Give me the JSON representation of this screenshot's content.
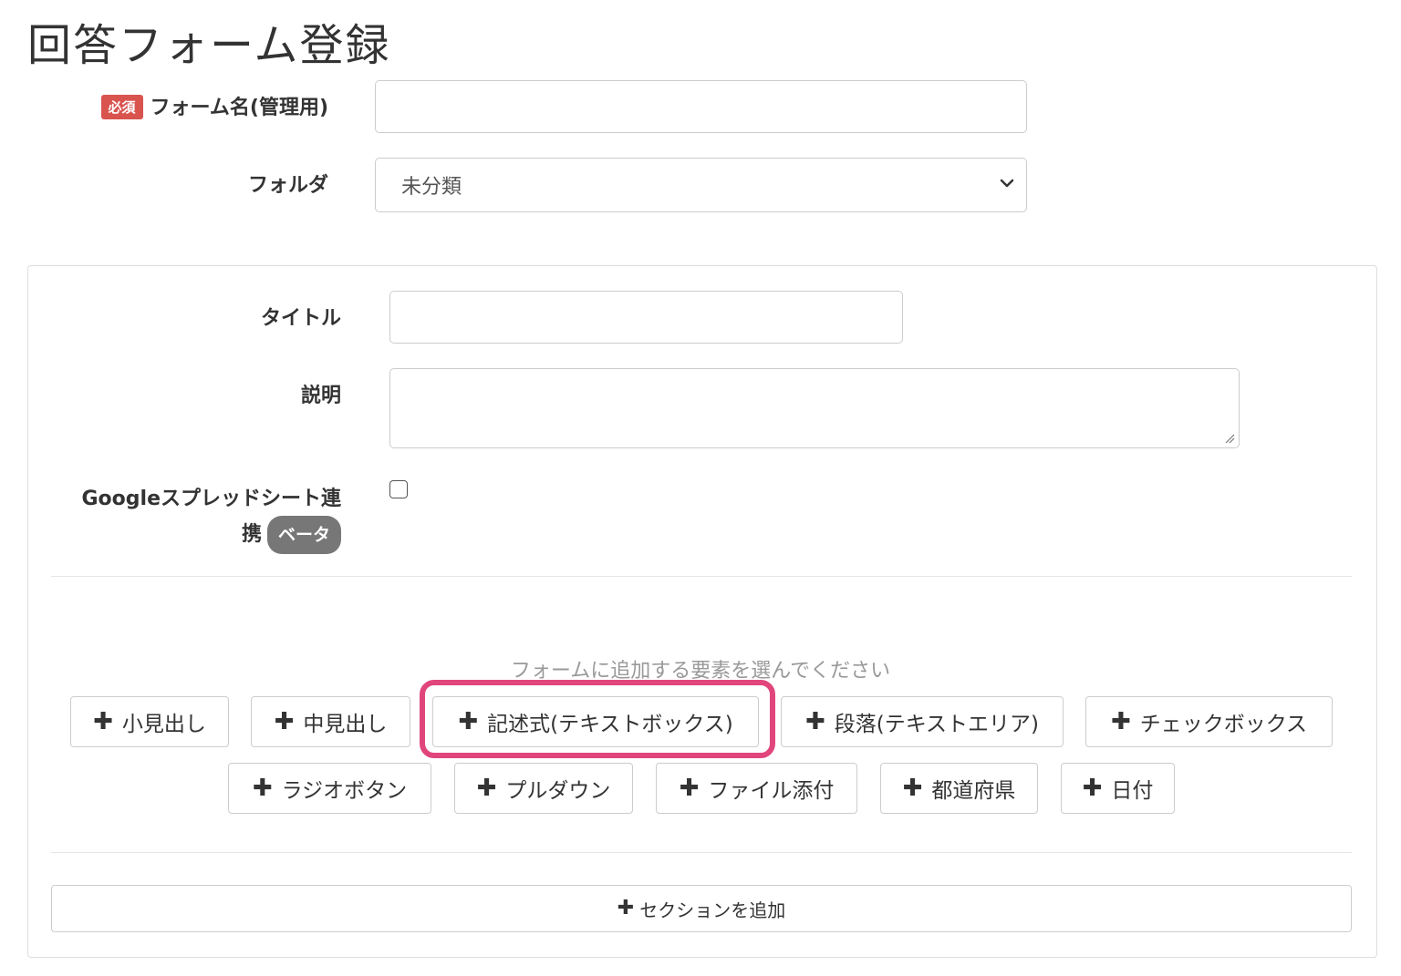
{
  "page_title": "回答フォーム登録",
  "form": {
    "required_badge": "必須",
    "name_label": "フォーム名(管理用)",
    "name_value": "",
    "folder_label": "フォルダ",
    "folder_selected": "未分類"
  },
  "panel": {
    "title_label": "タイトル",
    "title_value": "",
    "description_label": "説明",
    "description_value": "",
    "sheets_label_line1": "Googleスプレッドシート連",
    "sheets_label_line2": "携",
    "beta_badge": "ベータ",
    "sheets_checked": false,
    "hint": "フォームに追加する要素を選んでください",
    "add_buttons": [
      "小見出し",
      "中見出し",
      "記述式(テキストボックス)",
      "段落(テキストエリア)",
      "チェックボックス",
      "ラジオボタン",
      "プルダウン",
      "ファイル添付",
      "都道府県",
      "日付"
    ],
    "highlighted_button": "記述式(テキストボックス)",
    "highlight_color": "#e0457b",
    "add_section": "セクションを追加"
  },
  "colors": {
    "required": "#d9534f",
    "beta": "#777777",
    "hint": "#999999"
  }
}
